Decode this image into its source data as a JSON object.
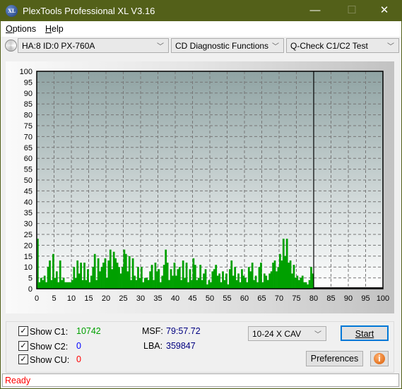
{
  "window": {
    "title": "PlexTools Professional XL V3.16",
    "logo_text": "XL",
    "minimize": "—",
    "maximize": "☐",
    "close": "✕"
  },
  "menu": [
    {
      "label": "Options",
      "accel": "O"
    },
    {
      "label": "Help",
      "accel": "H"
    }
  ],
  "toolbar": {
    "drive": "HA:8 ID:0  PX-760A",
    "function": "CD Diagnostic Functions",
    "test": "Q-Check C1/C2 Test"
  },
  "chart_data": {
    "type": "bar",
    "x_start": 0,
    "x_step": 0.5,
    "xlim": [
      0,
      100
    ],
    "ylim": [
      0,
      100
    ],
    "x_ticks": [
      0,
      5,
      10,
      15,
      20,
      25,
      30,
      35,
      40,
      45,
      50,
      55,
      60,
      65,
      70,
      75,
      80,
      85,
      90,
      95,
      100
    ],
    "y_ticks": [
      0,
      5,
      10,
      15,
      20,
      25,
      30,
      35,
      40,
      45,
      50,
      55,
      60,
      65,
      70,
      75,
      80,
      85,
      90,
      95,
      100
    ],
    "grid": true,
    "end_marker": 80,
    "series": [
      {
        "color": "#00a000",
        "values": [
          23,
          3,
          5,
          4,
          6,
          3,
          10,
          13,
          4,
          16,
          5,
          8,
          3,
          13,
          4,
          5,
          3,
          3,
          3,
          3,
          4,
          10,
          5,
          13,
          7,
          12,
          4,
          12,
          4,
          9,
          3,
          6,
          10,
          16,
          4,
          14,
          8,
          10,
          12,
          14,
          5,
          13,
          18,
          9,
          17,
          14,
          12,
          10,
          7,
          10,
          18,
          16,
          8,
          15,
          4,
          14,
          6,
          4,
          10,
          5,
          10,
          3,
          5,
          5,
          4,
          8,
          11,
          4,
          12,
          8,
          9,
          3,
          6,
          11,
          18,
          12,
          4,
          9,
          6,
          12,
          6,
          9,
          10,
          4,
          13,
          5,
          12,
          3,
          9,
          4,
          14,
          11,
          4,
          5,
          11,
          4,
          7,
          9,
          2,
          4,
          3,
          8,
          9,
          11,
          6,
          7,
          3,
          8,
          4,
          7,
          2,
          9,
          13,
          6,
          10,
          4,
          7,
          3,
          9,
          6,
          5,
          3,
          10,
          8,
          12,
          4,
          6,
          3,
          10,
          12,
          3,
          7,
          6,
          4,
          7,
          8,
          12,
          13,
          8,
          10,
          16,
          13,
          23,
          15,
          23,
          12,
          13,
          7,
          11,
          5,
          6,
          4,
          5,
          6,
          3,
          3,
          2,
          4,
          10,
          7
        ]
      }
    ]
  },
  "stats": {
    "show_c1": {
      "label": "Show C1:",
      "value": "10742",
      "checked": true,
      "color": "#00a000"
    },
    "show_c2": {
      "label": "Show C2:",
      "value": "0",
      "checked": true,
      "color": "#0000ff"
    },
    "show_cu": {
      "label": "Show CU:",
      "value": "0",
      "checked": true,
      "color": "#ff0000"
    },
    "msf": {
      "label": "MSF:",
      "value": "79:57.72"
    },
    "lba": {
      "label": "LBA:",
      "value": "359847"
    }
  },
  "controls": {
    "speed": "10-24 X CAV",
    "start": "Start",
    "preferences": "Preferences",
    "info": "i"
  },
  "status": "Ready"
}
